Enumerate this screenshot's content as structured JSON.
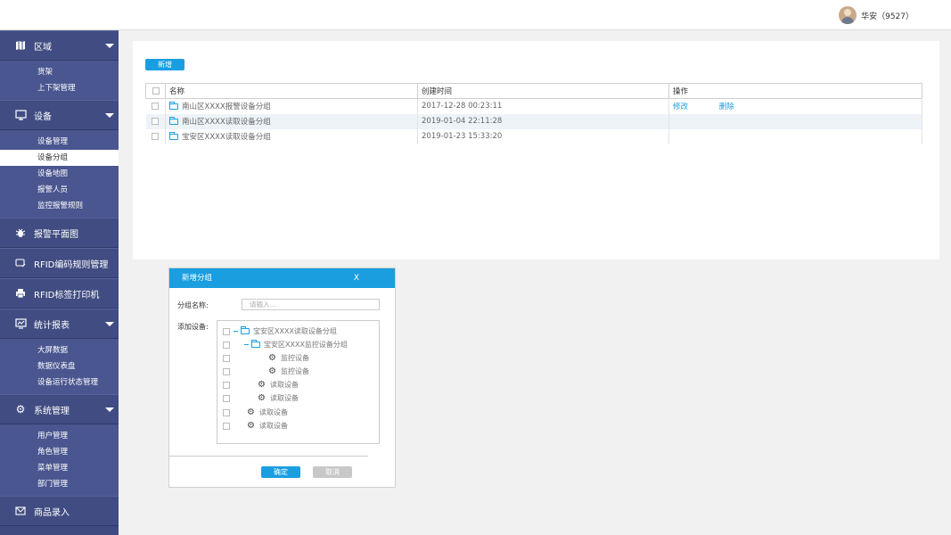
{
  "header": {
    "user_label": "华安（9527）"
  },
  "sidebar": {
    "groups": [
      {
        "label": "区域",
        "items": [
          "货架",
          "上下架管理"
        ]
      },
      {
        "label": "设备",
        "items": [
          "设备管理",
          "设备分组",
          "设备地图",
          "报警人员",
          "监控报警规则"
        ]
      },
      {
        "label": "报警平面图"
      },
      {
        "label": "RFID编码规则管理"
      },
      {
        "label": "RFID标签打印机"
      },
      {
        "label": "统计报表",
        "items": [
          "大屏数据",
          "数据仪表盘",
          "设备运行状态管理"
        ]
      },
      {
        "label": "系统管理",
        "items": [
          "用户管理",
          "角色管理",
          "菜单管理",
          "部门管理"
        ]
      },
      {
        "label": "商品录入"
      }
    ],
    "active_item": "设备分组"
  },
  "toolbar": {
    "add_label": "新增"
  },
  "table": {
    "columns": [
      "名称",
      "创建时间",
      "操作"
    ],
    "rows": [
      {
        "name": "南山区XXXX报警设备分组",
        "created": "2017-12-28 00:23:11",
        "edit": "修改",
        "delete": "删除"
      },
      {
        "name": "南山区XXXX读取设备分组",
        "created": "2019-01-04 22:11:28",
        "edit": "",
        "delete": ""
      },
      {
        "name": "宝安区XXXX读取设备分组",
        "created": "2019-01-23 15:33:20",
        "edit": "",
        "delete": ""
      }
    ]
  },
  "dialog": {
    "title": "新增分组",
    "close_label": "X",
    "name_label": "分组名称:",
    "name_placeholder": "请输入...",
    "devices_label": "添加设备:",
    "tree": [
      {
        "label": "宝安区XXXX读取设备分组",
        "type": "folder",
        "level": 0
      },
      {
        "label": "宝安区XXXX监控设备分组",
        "type": "folder",
        "level": 1
      },
      {
        "label": "监控设备",
        "type": "device",
        "level": 2
      },
      {
        "label": "监控设备",
        "type": "device",
        "level": 2
      },
      {
        "label": "读取设备",
        "type": "device",
        "level": 1
      },
      {
        "label": "读取设备",
        "type": "device",
        "level": 1
      },
      {
        "label": "读取设备",
        "type": "device",
        "level": 0
      },
      {
        "label": "读取设备",
        "type": "device",
        "level": 0
      }
    ],
    "ok_label": "确定",
    "cancel_label": "取消"
  },
  "colors": {
    "accent": "#1a9ee0",
    "sidebar": "#3f4b80",
    "sidebar_sub": "#4a5690"
  }
}
